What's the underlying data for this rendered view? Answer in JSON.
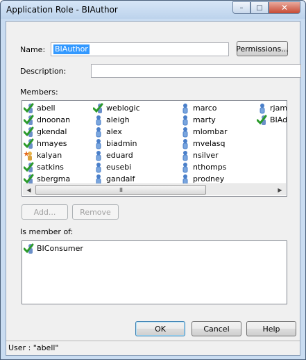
{
  "window": {
    "title": "Application Role - BIAuthor",
    "minimize": "–",
    "maximize": "□",
    "close": "✕"
  },
  "form": {
    "name_label": "Name:",
    "name_value": "BIAuthor",
    "permissions_button": "Permissions...",
    "description_label": "Description:",
    "description_value": "",
    "members_label": "Members:",
    "add_button": "Add...",
    "remove_button": "Remove",
    "is_member_of_label": "Is member of:"
  },
  "members": [
    {
      "name": "abell",
      "icon": "check-user-icon"
    },
    {
      "name": "dnoonan",
      "icon": "check-user-icon"
    },
    {
      "name": "gkendal",
      "icon": "check-user-icon"
    },
    {
      "name": "hmayes",
      "icon": "check-user-icon"
    },
    {
      "name": "kalyan",
      "icon": "star-user-icon"
    },
    {
      "name": "satkins",
      "icon": "check-user-icon"
    },
    {
      "name": "sbergma",
      "icon": "check-user-icon"
    },
    {
      "name": "weblogic",
      "icon": "check-user-icon"
    },
    {
      "name": "aleigh",
      "icon": "user-icon"
    },
    {
      "name": "alex",
      "icon": "user-icon"
    },
    {
      "name": "biadmin",
      "icon": "user-icon"
    },
    {
      "name": "eduard",
      "icon": "user-icon"
    },
    {
      "name": "eusebi",
      "icon": "user-icon"
    },
    {
      "name": "gandalf",
      "icon": "user-icon"
    },
    {
      "name": "marco",
      "icon": "user-icon"
    },
    {
      "name": "marty",
      "icon": "user-icon"
    },
    {
      "name": "mlombar",
      "icon": "user-icon"
    },
    {
      "name": "mvelasq",
      "icon": "user-icon"
    },
    {
      "name": "nsilver",
      "icon": "user-icon"
    },
    {
      "name": "nthomps",
      "icon": "user-icon"
    },
    {
      "name": "prodney",
      "icon": "user-icon"
    },
    {
      "name": "rjame",
      "icon": "user-icon"
    },
    {
      "name": "BIAdr",
      "icon": "check-user-icon"
    }
  ],
  "scrollbar": {
    "left_arrow": "◀",
    "right_arrow": "▶",
    "thumb_grip": "III"
  },
  "is_member_of": [
    {
      "name": "BIConsumer",
      "icon": "check-user-icon"
    }
  ],
  "buttons": {
    "ok": "OK",
    "cancel": "Cancel",
    "help": "Help"
  },
  "status": {
    "text": "User : \"abell\""
  },
  "colors": {
    "check_green": "#2a9a2a",
    "user_blue": "#4a7fc9",
    "selection": "#3399ff"
  }
}
